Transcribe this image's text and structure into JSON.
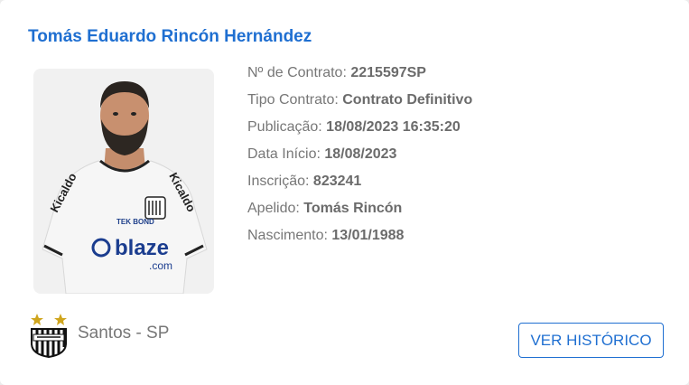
{
  "player": {
    "name": "Tomás Eduardo Rincón Hernández"
  },
  "details": [
    {
      "label": "Nº de Contrato: ",
      "value": "2215597SP"
    },
    {
      "label": "Tipo Contrato: ",
      "value": "Contrato Definitivo"
    },
    {
      "label": "Publicação: ",
      "value": "18/08/2023 16:35:20"
    },
    {
      "label": "Data Início: ",
      "value": "18/08/2023"
    },
    {
      "label": "Inscrição: ",
      "value": "823241"
    },
    {
      "label": "Apelido: ",
      "value": "Tomás Rincón"
    },
    {
      "label": "Nascimento: ",
      "value": "13/01/1988"
    }
  ],
  "photo": {
    "shirt_text": "blaze",
    "shirt_text_sub": ".com",
    "sleeve_text": "Kicaldo",
    "sponsor_text": "TEK BOND"
  },
  "club": {
    "name": "Santos - SP",
    "logo_icon": "santos-crest-icon"
  },
  "actions": {
    "history_label": "VER HISTÓRICO"
  },
  "colors": {
    "accent": "#1f6fd1",
    "label": "#777777",
    "value": "#6b6b6b"
  }
}
